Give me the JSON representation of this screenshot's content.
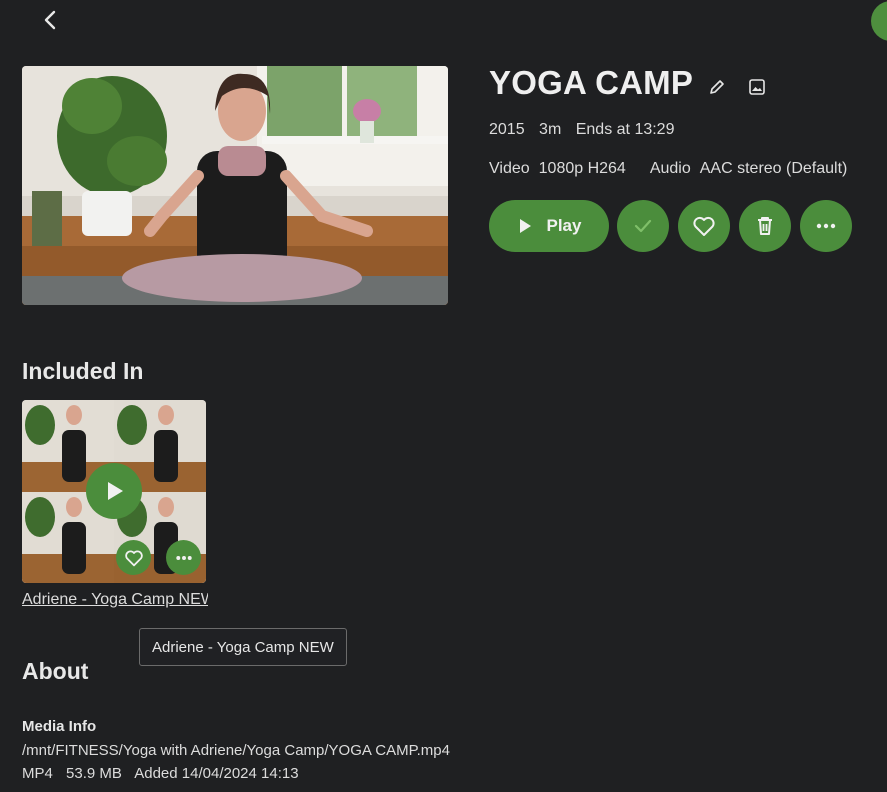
{
  "header": {
    "back_label": "Back"
  },
  "item": {
    "title": "YOGA CAMP",
    "year": "2015",
    "runtime": "3m",
    "ends_at": "Ends at 13:29",
    "video_label": "Video",
    "video_value": "1080p H264",
    "audio_label": "Audio",
    "audio_value": "AAC stereo (Default)"
  },
  "actions": {
    "play_label": "Play",
    "icons": [
      "play-icon",
      "check-icon",
      "heart-icon",
      "trash-icon",
      "more-icon",
      "pencil-icon",
      "image-icon"
    ]
  },
  "included": {
    "heading": "Included In",
    "card_title": "Adriene - Yoga Camp NEW",
    "tooltip": "Adriene - Yoga Camp NEW"
  },
  "about": {
    "heading": "About",
    "media_info_label": "Media Info",
    "path": "/mnt/FITNESS/Yoga with Adriene/Yoga Camp/YOGA CAMP.mp4",
    "container": "MP4",
    "size": "53.9 MB",
    "added": "Added 14/04/2024 14:13"
  },
  "colors": {
    "background": "#1f2022",
    "accent": "#4b8d3c",
    "text": "#e6e6e6"
  }
}
